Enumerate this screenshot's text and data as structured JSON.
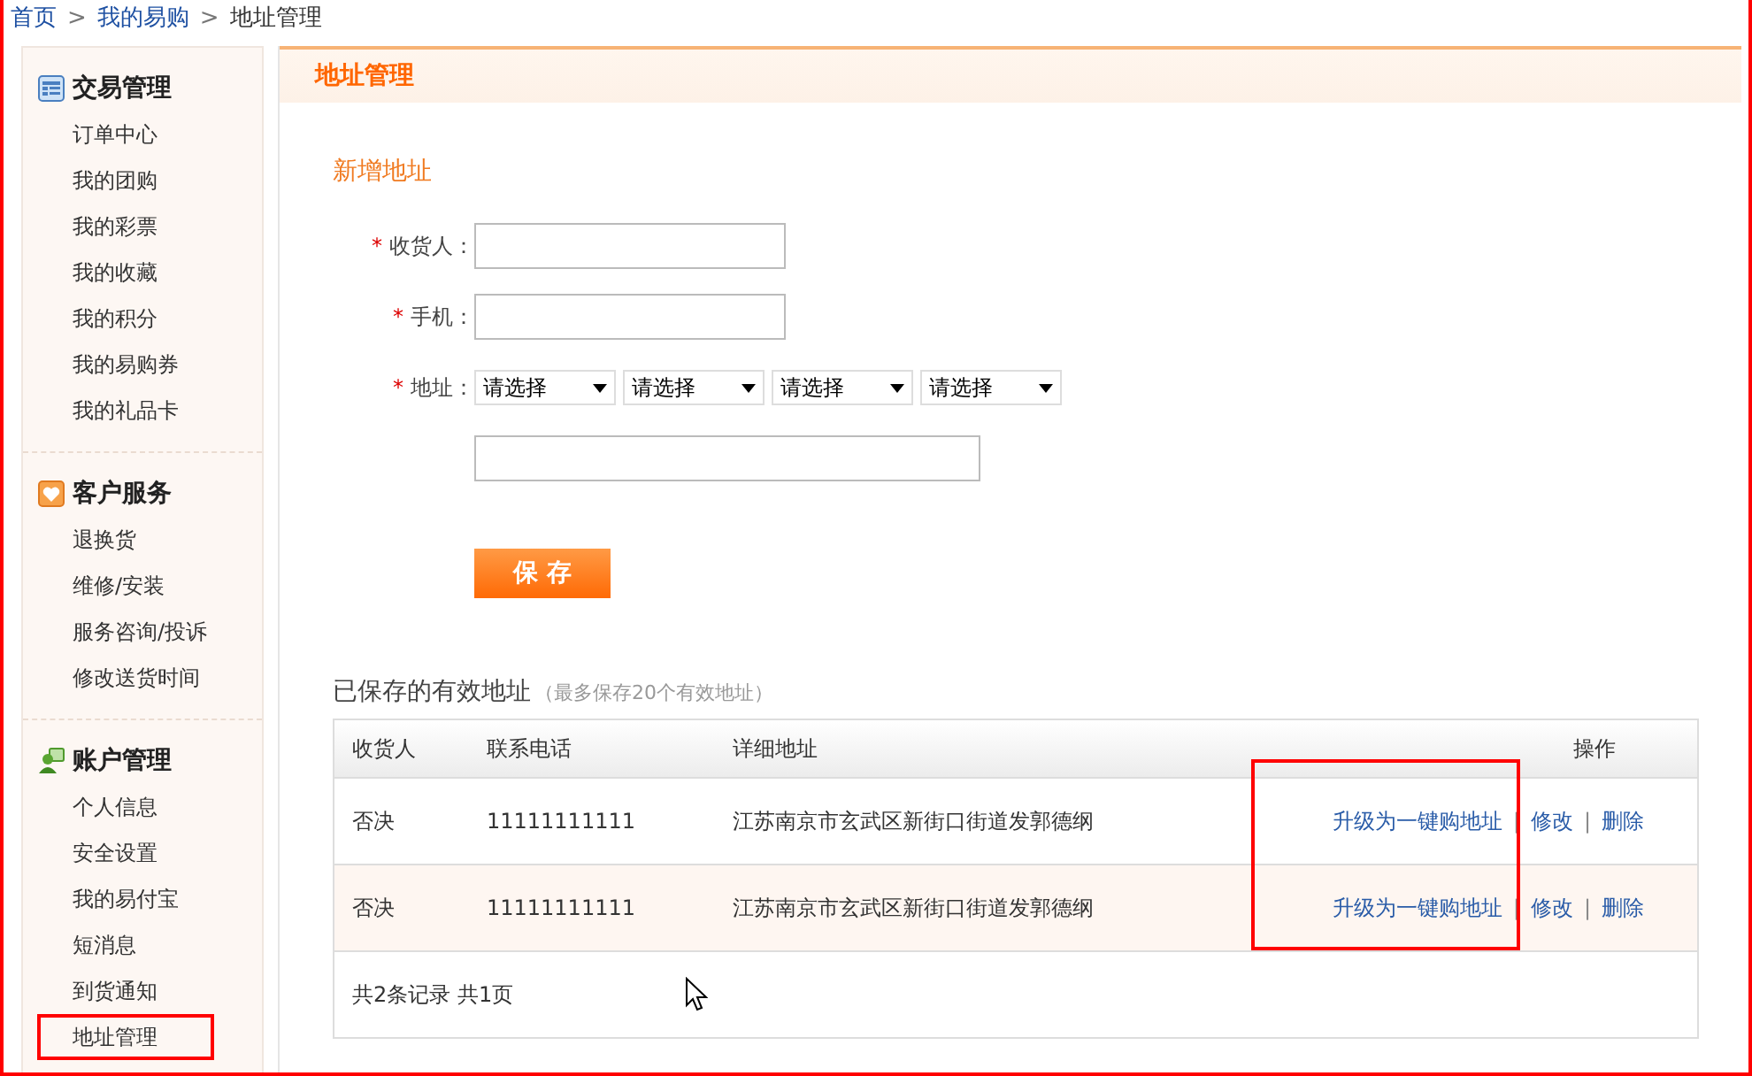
{
  "breadcrumb": {
    "separator": ">",
    "items": [
      {
        "label": "首页",
        "link": true
      },
      {
        "label": "我的易购",
        "link": true
      },
      {
        "label": "地址管理",
        "link": false
      }
    ]
  },
  "sidebar": {
    "sections": [
      {
        "title": "交易管理",
        "items": [
          {
            "label": "订单中心",
            "highlighted": false
          },
          {
            "label": "我的团购",
            "highlighted": false
          },
          {
            "label": "我的彩票",
            "highlighted": false
          },
          {
            "label": "我的收藏",
            "highlighted": false
          },
          {
            "label": "我的积分",
            "highlighted": false
          },
          {
            "label": "我的易购券",
            "highlighted": false
          },
          {
            "label": "我的礼品卡",
            "highlighted": false
          }
        ]
      },
      {
        "title": "客户服务",
        "items": [
          {
            "label": "退换货",
            "highlighted": false
          },
          {
            "label": "维修/安装",
            "highlighted": false
          },
          {
            "label": "服务咨询/投诉",
            "highlighted": false
          },
          {
            "label": "修改送货时间",
            "highlighted": false
          }
        ]
      },
      {
        "title": "账户管理",
        "items": [
          {
            "label": "个人信息",
            "highlighted": false
          },
          {
            "label": "安全设置",
            "highlighted": false
          },
          {
            "label": "我的易付宝",
            "highlighted": false
          },
          {
            "label": "短消息",
            "highlighted": false
          },
          {
            "label": "到货通知",
            "highlighted": false
          },
          {
            "label": "地址管理",
            "highlighted": true
          }
        ]
      }
    ]
  },
  "panel": {
    "title": "地址管理",
    "form": {
      "title": "新增地址",
      "fields": [
        {
          "kind": "text",
          "marker": "*",
          "label": "收货人："
        },
        {
          "kind": "text",
          "marker": "*",
          "label": "手机："
        },
        {
          "kind": "selects",
          "marker": "*",
          "label": "地址：",
          "selects": [
            "请选择",
            "请选择",
            "请选择",
            "请选择"
          ]
        },
        {
          "kind": "wide-text"
        }
      ],
      "save_button": "保 存"
    },
    "saved": {
      "title": "已保存的有效地址",
      "note": "（最多保存20个有效地址）",
      "columns": [
        "收货人",
        "联系电话",
        "详细地址",
        "操作"
      ],
      "rows": [
        {
          "cells": [
            "否决",
            "11111111111",
            "江苏南京市玄武区新街口街道发郭德纲"
          ],
          "actions": [
            "升级为一键购地址",
            "修改",
            "删除"
          ]
        },
        {
          "cells": [
            "否决",
            "11111111111",
            "江苏南京市玄武区新街口街道发郭德纲"
          ],
          "actions": [
            "升级为一键购地址",
            "修改",
            "删除"
          ]
        }
      ],
      "action_separator": "|",
      "footer": "共2条记录 共1页",
      "annotation_box": true
    }
  }
}
